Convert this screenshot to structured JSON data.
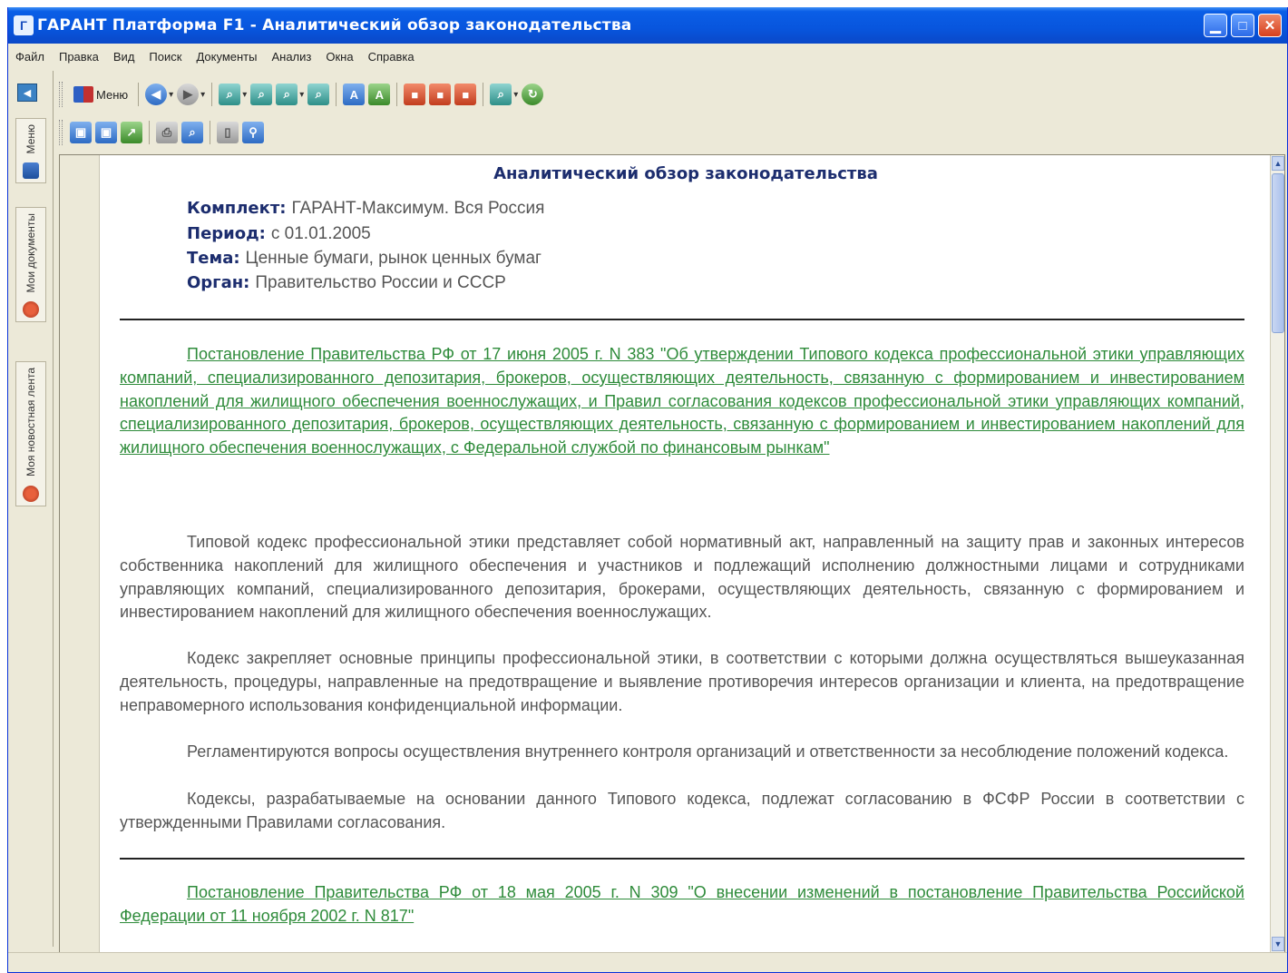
{
  "window": {
    "title": "ГАРАНТ Платформа F1 - Аналитический обзор законодательства",
    "app_icon": "garant-app-icon",
    "controls": {
      "minimize": "minimize-icon",
      "maximize": "maximize-icon",
      "close": "close-icon"
    }
  },
  "menubar": {
    "items": [
      "Файл",
      "Правка",
      "Вид",
      "Поиск",
      "Документы",
      "Анализ",
      "Окна",
      "Справка"
    ]
  },
  "sidebar": {
    "tabs": [
      {
        "label": "Меню",
        "icon": "menu-icon"
      },
      {
        "label": "Мои документы",
        "icon": "my-documents-icon"
      },
      {
        "label": "Моя новостная лента",
        "icon": "news-feed-icon"
      }
    ]
  },
  "toolbar": {
    "menu_label": "Меню"
  },
  "document": {
    "title": "Аналитический обзор законодательства",
    "meta": [
      {
        "label": "Комплект:",
        "value": "ГАРАНТ-Максимум. Вся Россия"
      },
      {
        "label": "Период:",
        "value": "с 01.01.2005"
      },
      {
        "label": "Тема:",
        "value": "Ценные бумаги, рынок ценных бумаг"
      },
      {
        "label": "Орган:",
        "value": "Правительство России и СССР"
      }
    ],
    "links": [
      "Постановление Правительства РФ от 17 июня 2005 г. N 383 \"Об утверждении Типового кодекса профессиональной этики управляющих компаний, специализированного депозитария, брокеров, осуществляющих деятельность, связанную с формированием и инвестированием накоплений для жилищного обеспечения военнослужащих, и Правил согласования кодексов профессиональной этики управляющих компаний, специализированного депозитария, брокеров, осуществляющих деятельность, связанную с формированием и инвестированием накоплений для жилищного обеспечения военнослужащих, с Федеральной службой по финансовым рынкам\"",
      "Постановление Правительства РФ от 18 мая 2005 г. N 309 \"О внесении изменений в постановление Правительства Российской Федерации от 11 ноября 2002 г. N 817\""
    ],
    "paragraphs": [
      "Типовой кодекс профессиональной этики представляет собой нормативный акт, направленный на защиту прав и законных интересов собственника накоплений для жилищного обеспечения и участников и подлежащий исполнению должностными лицами и сотрудниками управляющих компаний, специализированного депозитария, брокерами, осуществляющих деятельность, связанную с формированием и инвестированием накоплений для жилищного обеспечения военнослужащих.",
      "Кодекс закрепляет основные принципы профессиональной этики, в соответствии с которыми должна осуществляться вышеуказанная деятельность, процедуры, направленные на предотвращение и выявление противоречия интересов организации и клиента, на предотвращение неправомерного использования конфиденциальной информации.",
      "Регламентируются вопросы осуществления внутреннего контроля организаций и ответственности за несоблюдение положений кодекса.",
      "Кодексы, разрабатываемые на основании данного Типового кодекса, подлежат согласованию в ФСФР России в соответствии с утвержденными Правилами согласования."
    ]
  },
  "colors": {
    "titlebar": "#0855dd",
    "link": "#2e8b3a",
    "heading": "#1c2d6e",
    "body_text": "#555555",
    "chrome": "#ece9d8"
  }
}
